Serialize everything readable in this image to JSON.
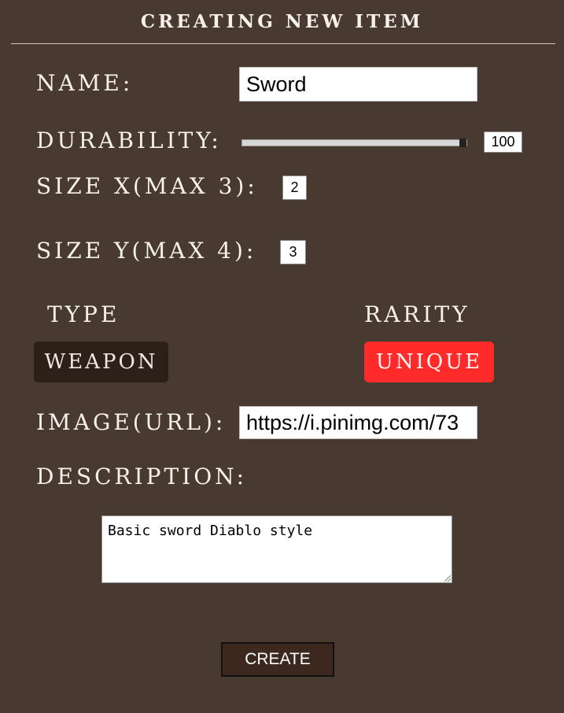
{
  "form": {
    "title": "CREATING NEW ITEM",
    "name": {
      "label": "NAME:",
      "value": "Sword"
    },
    "durability": {
      "label": "DURABILITY:",
      "value": "100",
      "fraction": 1.0
    },
    "size_x": {
      "label": "SIZE X(MAX 3):",
      "value": "2"
    },
    "size_y": {
      "label": "SIZE Y(MAX 4):",
      "value": "3"
    },
    "type": {
      "label": "TYPE",
      "value": "WEAPON"
    },
    "rarity": {
      "label": "RARITY",
      "value": "UNIQUE",
      "color": "#ff2b2b"
    },
    "image": {
      "label": "IMAGE(URL):",
      "value": "https://i.pinimg.com/73"
    },
    "description": {
      "label": "DESCRIPTION:",
      "value": "Basic sword Diablo style"
    },
    "create_label": "CREATE"
  },
  "colors": {
    "background": "#483a31",
    "type_button": "#2c2019",
    "rarity_button": "#ff2b2b",
    "create_button": "#3d2820"
  }
}
